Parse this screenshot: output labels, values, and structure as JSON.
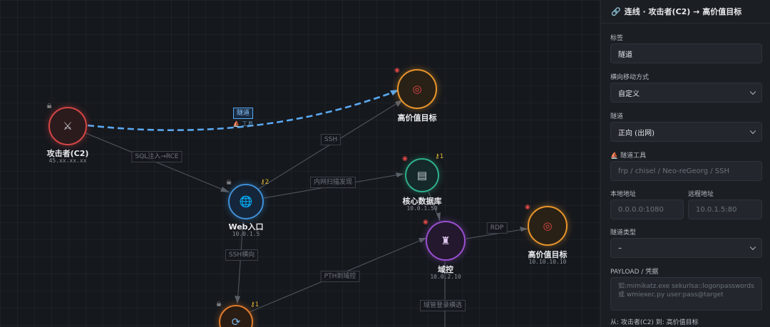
{
  "panel": {
    "title": "连线 · 攻击者(C2) → 高价值目标",
    "link_icon": "link-icon",
    "label_field": {
      "label": "标签",
      "value": "隧道"
    },
    "movement_field": {
      "label": "横向移动方式",
      "value": "自定义"
    },
    "tunnel_field": {
      "label": "隧道",
      "value": "正向 (出网)"
    },
    "tool_field": {
      "label": "隧道工具",
      "icon": "tunnel-tool-icon",
      "placeholder": "frp / chisel / Neo-reGeorg / SSH"
    },
    "local_addr": {
      "label": "本地地址",
      "placeholder": "0.0.0.0:1080"
    },
    "remote_addr": {
      "label": "远程地址",
      "placeholder": "10.0.1.5:80"
    },
    "tunnel_type": {
      "label": "隧道类型",
      "value": "–"
    },
    "payload": {
      "label": "PAYLOAD / 凭据",
      "placeholder_line1": "如:mimikatz.exe sekurlsa::logonpasswords",
      "placeholder_line2": "或 wmiexec.py user:pass@target"
    },
    "footer": "从: 攻击者(C2)  到: 高价值目标"
  },
  "nodes": {
    "attacker": {
      "name": "攻击者(C2)",
      "ip": "45.xx.xx.xx",
      "icon": "crossed-swords-icon",
      "badge_icon": "skull-icon",
      "color": "#d64545"
    },
    "hvt1": {
      "name": "高价值目标",
      "ip": "",
      "icon": "target-icon",
      "badge_icon": "target-icon",
      "color": "#e8952a"
    },
    "web": {
      "name": "Web入口",
      "ip": "10.0.1.5",
      "icon": "globe-icon",
      "badge_icon": "skull-icon",
      "key_count": "2",
      "color": "#3f8fd6"
    },
    "db": {
      "name": "核心数据库",
      "ip": "10.0.1.50",
      "icon": "database-icon",
      "badge_icon": "target-icon",
      "key_count": "1",
      "color": "#2fae8a"
    },
    "dc": {
      "name": "域控",
      "ip": "10.0.2.10",
      "icon": "castle-icon",
      "badge_icon": "target-icon",
      "color": "#9a4fd0"
    },
    "hvt2": {
      "name": "高价值目标",
      "ip": "10.10.10.10",
      "icon": "target-icon",
      "badge_icon": "target-icon",
      "color": "#e8952a"
    },
    "pivot": {
      "name": "",
      "ip": "",
      "icon": "refresh-icon",
      "badge_icon": "skull-icon",
      "key_count": "1",
      "color": "#e07a2a"
    }
  },
  "edges": {
    "tunnel": {
      "label": "隧道",
      "tool": "工具",
      "tool_icon": "tunnel-tool-icon",
      "color": "#5aa8f0"
    },
    "sqli": "SQL注入→RCE",
    "ssh1": "SSH",
    "scan": "内网扫描发现",
    "ssh_lateral": "SSH横向",
    "pth": "PTH到域控",
    "rdp": "RDP",
    "domain_login": "域管登录横选"
  }
}
